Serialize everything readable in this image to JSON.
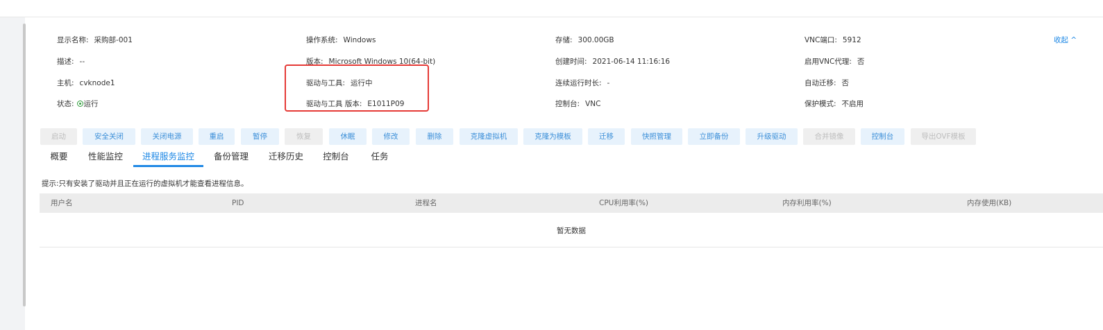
{
  "info": {
    "display_name_label": "显示名称:",
    "display_name_value": "采购部-001",
    "os_label": "操作系统:",
    "os_value": "Windows",
    "storage_label": "存储:",
    "storage_value": "300.00GB",
    "vnc_port_label": "VNC端口:",
    "vnc_port_value": "5912",
    "desc_label": "描述:",
    "desc_value": "--",
    "version_label": "版本:",
    "version_value": "Microsoft Windows 10(64-bit)",
    "created_label": "创建时间:",
    "created_value": "2021-06-14 11:16:16",
    "vnc_proxy_label": "启用VNC代理:",
    "vnc_proxy_value": "否",
    "host_label": "主机:",
    "host_value": "cvknode1",
    "driver_label": "驱动与工具:",
    "driver_value": "运行中",
    "uptime_label": "连续运行时长:",
    "uptime_value": "-",
    "auto_migrate_label": "自动迁移:",
    "auto_migrate_value": "否",
    "status_label": "状态:",
    "status_value": "运行",
    "driver_version_label": "驱动与工具 版本:",
    "driver_version_value": "E1011P09",
    "console_label": "控制台:",
    "console_value": "VNC",
    "protect_label": "保护模式:",
    "protect_value": "不启用",
    "collapse_label": "收起 ^"
  },
  "toolbar": {
    "start": "启动",
    "safe_shutdown": "安全关闭",
    "power_off": "关闭电源",
    "restart": "重启",
    "pause": "暂停",
    "resume": "恢复",
    "hibernate": "休眠",
    "modify": "修改",
    "delete": "删除",
    "clone_vm": "克隆虚拟机",
    "clone_template": "克隆为模板",
    "migrate": "迁移",
    "snapshot": "快照管理",
    "backup_now": "立即备份",
    "upgrade_driver": "升级驱动",
    "merge_image": "合并镜像",
    "console": "控制台",
    "export_ovf": "导出OVF模板"
  },
  "tabs": {
    "overview": "概要",
    "performance": "性能监控",
    "process": "进程服务监控",
    "backup": "备份管理",
    "migration": "迁移历史",
    "console": "控制台",
    "tasks": "任务"
  },
  "hint": "提示:只有安装了驱动并且正在运行的虚拟机才能查看进程信息。",
  "table": {
    "columns": {
      "user": "用户名",
      "pid": "PID",
      "process": "进程名",
      "cpu": "CPU利用率(%)",
      "mem_rate": "内存利用率(%)",
      "mem_used": "内存使用(KB)"
    },
    "empty": "暂无数据"
  },
  "colors": {
    "accent": "#1e88e5",
    "button_bg": "#e7f2fc",
    "button_text": "#3c8fd8",
    "disabled_bg": "#efefef",
    "running": "#2e9c3a",
    "highlight": "#e53935"
  }
}
